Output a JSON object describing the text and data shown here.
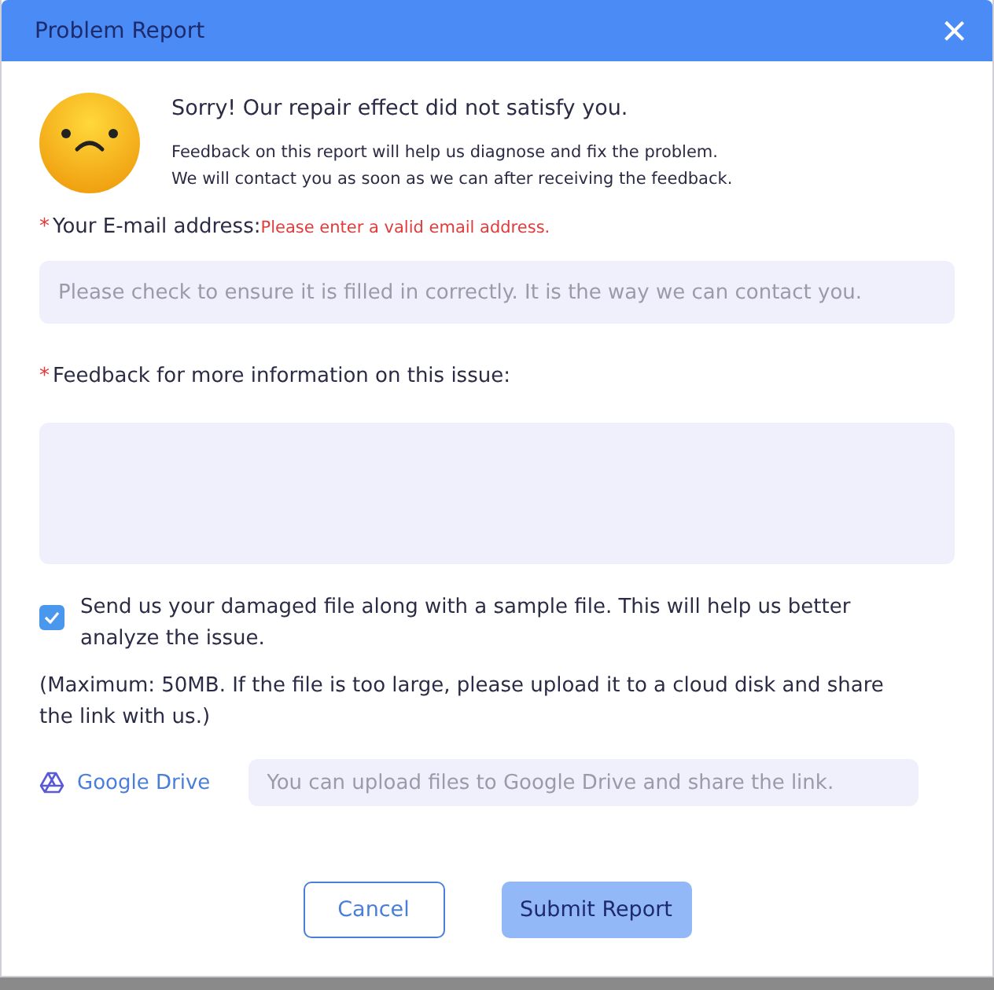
{
  "window": {
    "title": "Problem Report",
    "close": "×"
  },
  "intro": {
    "heading": "Sorry! Our repair effect did not satisfy you.",
    "lines": [
      "Feedback on this report will help us diagnose and fix the problem.",
      "We will contact you as soon as we can after receiving the feedback."
    ]
  },
  "email": {
    "required_mark": "*",
    "label": "Your E-mail address:",
    "error": "Please enter a valid email address.",
    "placeholder": "Please check to ensure it is filled in correctly. It is the way we can contact you."
  },
  "feedback": {
    "required_mark": "*",
    "label": "Feedback for more information on this issue:"
  },
  "attach": {
    "checked": true,
    "label": "Send us your damaged file along with a sample file. This will help us better analyze the issue."
  },
  "note": "(Maximum: 50MB. If the file is too large, please upload it to a cloud disk and share the link with us.)",
  "drive": {
    "link": "Google Drive",
    "placeholder": "You can upload files to Google Drive and share the link."
  },
  "buttons": [
    {
      "kind": "secondary",
      "label": "Cancel"
    },
    {
      "kind": "primary",
      "label": "Submit Report"
    }
  ]
}
